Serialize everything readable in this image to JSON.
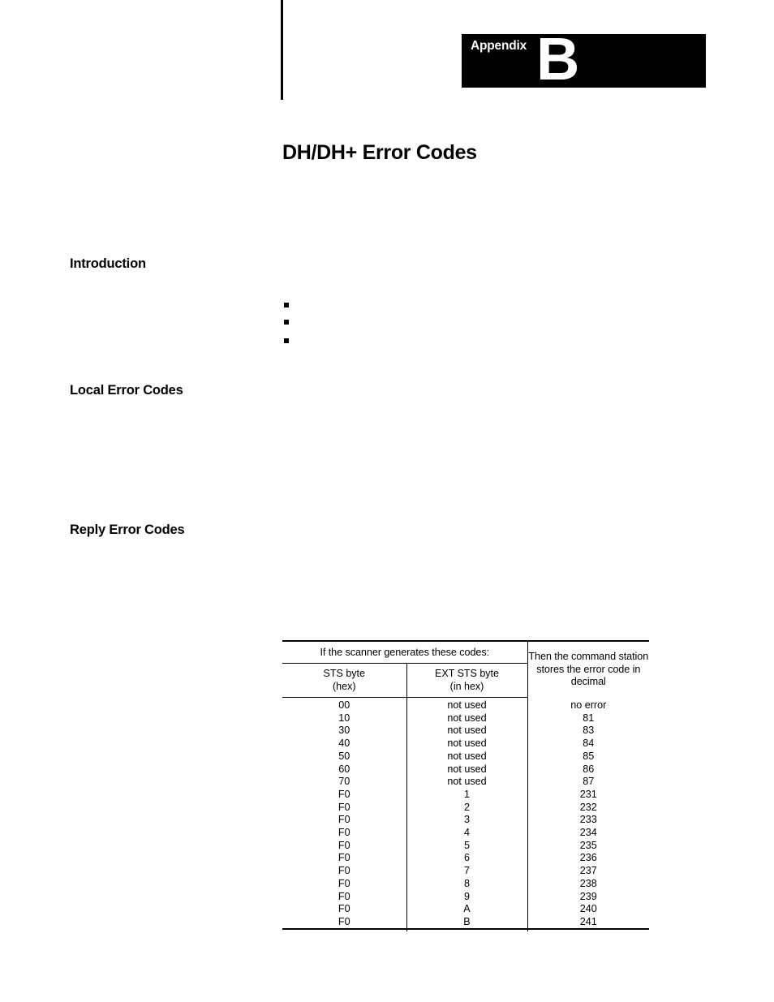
{
  "header": {
    "appendix_label": "Appendix",
    "appendix_letter": "B"
  },
  "title": "DH/DH+ Error Codes",
  "sections": [
    {
      "heading": "Introduction"
    },
    {
      "heading": "Local Error Codes"
    },
    {
      "heading": "Reply Error Codes"
    }
  ],
  "bullets": [
    {
      "marker": "square"
    },
    {
      "marker": "square"
    },
    {
      "marker": "square"
    }
  ],
  "table": {
    "group_header_left": "If the scanner generates these codes:",
    "group_header_right": "Then the command station stores the error code in decimal",
    "columns": [
      {
        "line1": "STS byte",
        "line2": "(hex)",
        "bold": false
      },
      {
        "line1": "EXT STS byte",
        "line2": "(in hex)",
        "bold": true
      }
    ],
    "rows": [
      {
        "sts": "00",
        "ext": "not used",
        "decimal": "no error"
      },
      {
        "sts": "10",
        "ext": "not used",
        "decimal": "81"
      },
      {
        "sts": "30",
        "ext": "not used",
        "decimal": "83"
      },
      {
        "sts": "40",
        "ext": "not used",
        "decimal": "84"
      },
      {
        "sts": "50",
        "ext": "not used",
        "decimal": "85"
      },
      {
        "sts": "60",
        "ext": "not used",
        "decimal": "86"
      },
      {
        "sts": "70",
        "ext": "not used",
        "decimal": "87"
      },
      {
        "sts": "F0",
        "ext": "1",
        "decimal": "231"
      },
      {
        "sts": "F0",
        "ext": "2",
        "decimal": "232"
      },
      {
        "sts": "F0",
        "ext": "3",
        "decimal": "233"
      },
      {
        "sts": "F0",
        "ext": "4",
        "decimal": "234"
      },
      {
        "sts": "F0",
        "ext": "5",
        "decimal": "235"
      },
      {
        "sts": "F0",
        "ext": "6",
        "decimal": "236"
      },
      {
        "sts": "F0",
        "ext": "7",
        "decimal": "237"
      },
      {
        "sts": "F0",
        "ext": "8",
        "decimal": "238"
      },
      {
        "sts": "F0",
        "ext": "9",
        "decimal": "239"
      },
      {
        "sts": "F0",
        "ext": "A",
        "decimal": "240"
      },
      {
        "sts": "F0",
        "ext": "B",
        "decimal": "241"
      }
    ]
  },
  "colors": {
    "ink": "#000000",
    "paper": "#ffffff"
  }
}
